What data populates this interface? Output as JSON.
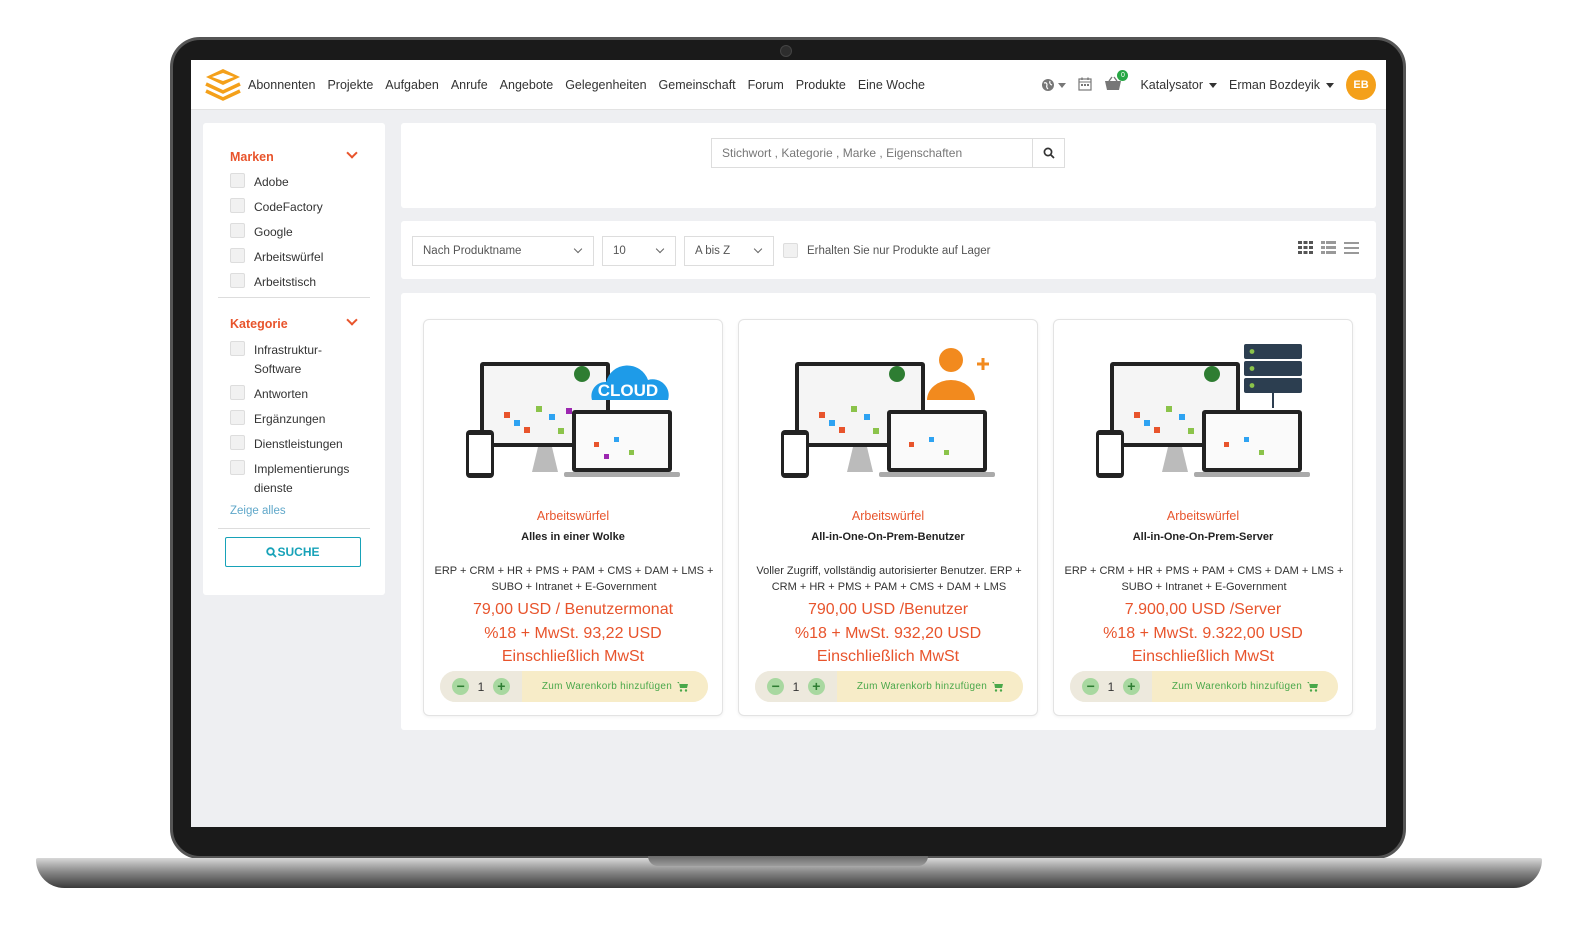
{
  "header": {
    "nav": [
      "Abonnenten",
      "Projekte",
      "Aufgaben",
      "Anrufe",
      "Angebote",
      "Gelegenheiten",
      "Gemeinschaft",
      "Forum",
      "Produkte",
      "Eine Woche"
    ],
    "cart_count": "0",
    "catalog_label": "Katalysator",
    "user_name": "Erman Bozdeyik",
    "user_initials": "EB"
  },
  "sidebar": {
    "brands_title": "Marken",
    "brands": [
      "Adobe",
      "CodeFactory",
      "Google",
      "Arbeitswürfel",
      "Arbeitstisch"
    ],
    "category_title": "Kategorie",
    "categories": [
      "Infrastruktur-\nSoftware",
      "Antworten",
      "Ergänzungen",
      "Dienstleistungen",
      "Implementierungs\ndienste"
    ],
    "show_all": "Zeige alles",
    "search_button": "SUCHE"
  },
  "search": {
    "placeholder": "Stichwort , Kategorie , Marke , Eigenschaften"
  },
  "filters": {
    "sort_by": "Nach Produktname",
    "page_size": "10",
    "order": "A bis Z",
    "in_stock_label": "Erhalten Sie nur Produkte auf Lager"
  },
  "products": [
    {
      "brand": "Arbeitswürfel",
      "name": "Alles in einer Wolke",
      "description": "ERP + CRM + HR + PMS + PAM + CMS + DAM + LMS + SUBO + Intranet + E-Government",
      "price": "79,00 USD / Benutzermonat",
      "tax": "%18 + MwSt. 93,22 USD",
      "tax_note": "Einschließlich MwSt",
      "qty": "1",
      "badge": "CLOUD",
      "add_label": "Zum Warenkorb hinzufügen"
    },
    {
      "brand": "Arbeitswürfel",
      "name": "All-in-One-On-Prem-Benutzer",
      "description": "Voller Zugriff, vollständig autorisierter Benutzer. ERP + CRM + HR + PMS + PAM + CMS + DAM + LMS",
      "price": "790,00 USD /Benutzer",
      "tax": "%18 + MwSt. 932,20 USD",
      "tax_note": "Einschließlich MwSt",
      "qty": "1",
      "badge": "",
      "add_label": "Zum Warenkorb hinzufügen"
    },
    {
      "brand": "Arbeitswürfel",
      "name": "All-in-One-On-Prem-Server",
      "description": "ERP + CRM + HR + PMS + PAM + CMS + DAM + LMS + SUBO + Intranet + E-Government",
      "price": "7.900,00 USD /Server",
      "tax": "%18 + MwSt. 9.322,00 USD",
      "tax_note": "Einschließlich MwSt",
      "qty": "1",
      "badge": "",
      "add_label": "Zum Warenkorb hinzufügen"
    }
  ],
  "colors": {
    "accent": "#e8542c",
    "avatar": "#f4a01a",
    "cloud": "#1e9be8",
    "user_icon": "#f28a1e",
    "success": "#28a745"
  }
}
